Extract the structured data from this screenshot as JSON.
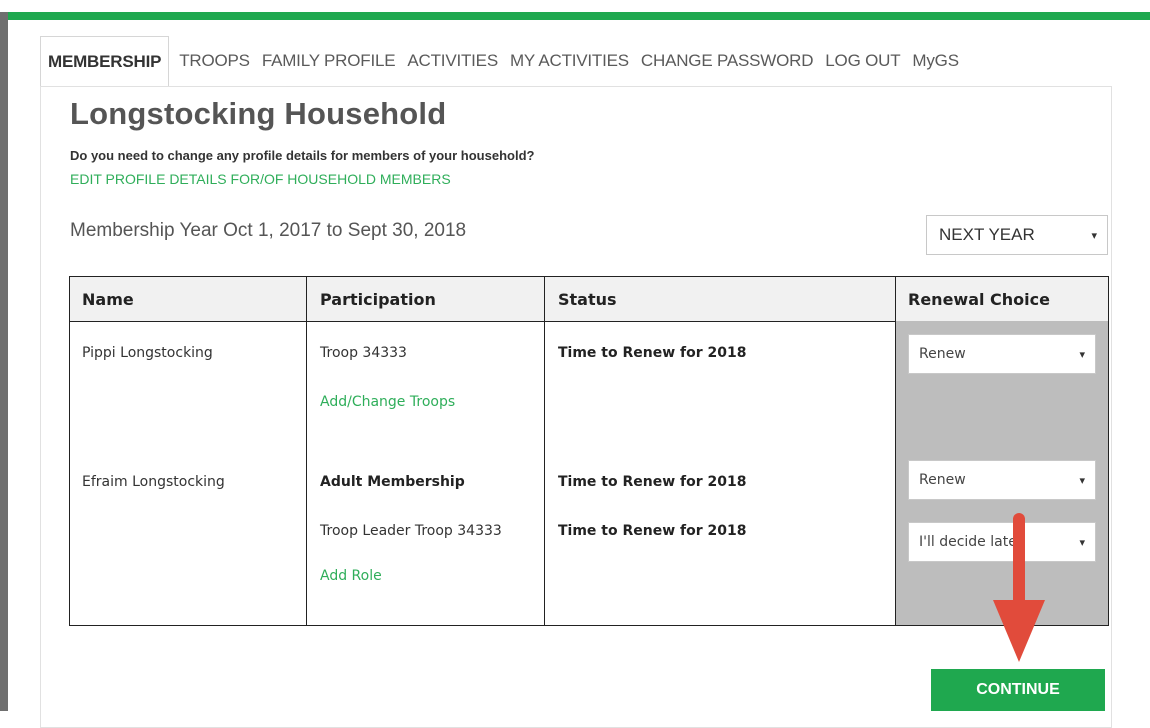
{
  "nav": {
    "tabs": [
      {
        "label": "MEMBERSHIP",
        "active": true
      },
      {
        "label": "TROOPS"
      },
      {
        "label": "FAMILY PROFILE"
      },
      {
        "label": "ACTIVITIES"
      },
      {
        "label": "MY ACTIVITIES"
      },
      {
        "label": "CHANGE PASSWORD"
      },
      {
        "label": "LOG OUT"
      },
      {
        "label": "MyGS"
      }
    ]
  },
  "page": {
    "title": "Longstocking Household",
    "question": "Do you need to change any profile details for members of your household?",
    "edit_link": "EDIT PROFILE DETAILS FOR/OF HOUSEHOLD MEMBERS",
    "membership_year": "Membership Year Oct 1, 2017 to Sept 30, 2018",
    "year_select": "NEXT YEAR"
  },
  "table": {
    "headers": {
      "name": "Name",
      "participation": "Participation",
      "status": "Status",
      "renewal": "Renewal Choice"
    },
    "members": [
      {
        "name": "Pippi Longstocking",
        "participation": "Troop 34333",
        "add_link": "Add/Change Troops",
        "status": "Time to Renew for 2018",
        "renewal": "Renew"
      },
      {
        "name": "Efraim Longstocking",
        "participation": "Adult Membership",
        "status": "Time to Renew for 2018",
        "renewal": "Renew",
        "role": "Troop Leader Troop 34333",
        "role_status": "Time to Renew for 2018",
        "role_renewal": "I'll decide later",
        "add_link": "Add Role"
      }
    ]
  },
  "continue_label": "CONTINUE",
  "colors": {
    "brand_green": "#1fa84f",
    "link_green": "#2fae5a",
    "arrow_red": "#e14b3b"
  }
}
